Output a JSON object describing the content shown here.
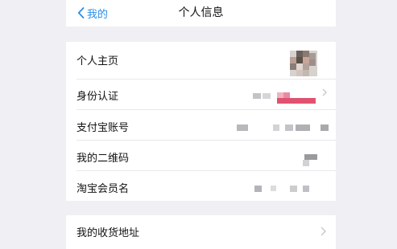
{
  "nav": {
    "back_label": "我的",
    "title": "个人信息"
  },
  "profile": {
    "rows": [
      {
        "label": "个人主页"
      },
      {
        "label": "身份认证"
      },
      {
        "label": "支付宝账号"
      },
      {
        "label": "我的二维码"
      },
      {
        "label": "淘宝会员名"
      }
    ]
  },
  "address": {
    "label": "我的收货地址"
  },
  "colors": {
    "accent": "#2a8ee8",
    "badge": "#e0526f"
  }
}
